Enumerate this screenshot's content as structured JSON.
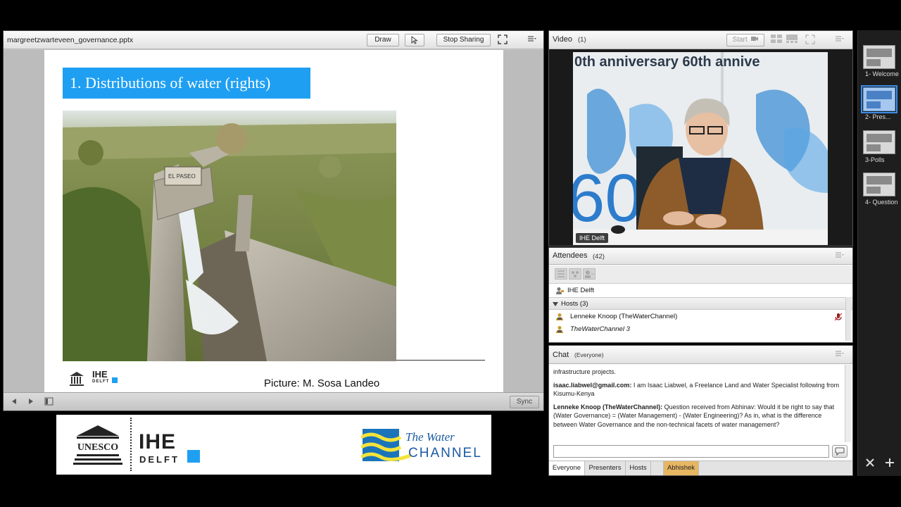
{
  "share_pod": {
    "filename": "margreetzwarteveen_governance.pptx",
    "draw_label": "Draw",
    "stop_sharing_label": "Stop Sharing",
    "sync_label": "Sync"
  },
  "slide": {
    "title": "1. Distributions of water (rights)",
    "logo_text": "IHE",
    "logo_sub": "DELFT",
    "caption": "Picture: M. Sosa Landeo",
    "sign_text": "EL PASEO"
  },
  "banner": {
    "unesco": "UNESCO",
    "ihe": "IHE",
    "delft": "DELFT",
    "wc_line1": "The Water",
    "wc_line2": "CHANNEL"
  },
  "video_pod": {
    "title": "Video",
    "count": "(1)",
    "start_label": "Start",
    "camera_label": "IHE Delft",
    "backdrop_text": "0th anniversary   60th annive",
    "backdrop_num": "60   60"
  },
  "attendees": {
    "title": "Attendees",
    "count": "(42)",
    "presenter": "IHE Delft",
    "hosts_label": "Hosts (3)",
    "hosts": [
      "Lenneke Knoop (TheWaterChannel)",
      "TheWaterChannel 3"
    ]
  },
  "chat": {
    "title": "Chat",
    "scope": "(Everyone)",
    "messages": [
      {
        "sender": "",
        "text": "infrastructure projects."
      },
      {
        "sender": "isaac.liabwel@gmail.com:",
        "text": " I am Isaac Liabwel, a Freelance Land and Water Specialist following from Kisumu-Kenya"
      },
      {
        "sender": "Lenneke Knoop (TheWaterChannel):",
        "text": " Question received from Abhinav: Would it be right to say that (Water Governance) = (Water Management) - (Water Engineering)? As in, what is the difference between Water Governance and the non-technical facets of water management?"
      }
    ],
    "tabs": [
      "Everyone",
      "Presenters",
      "Hosts",
      "Abhishek"
    ]
  },
  "thumbnails": [
    {
      "label": "1- Welcome"
    },
    {
      "label": "2- Pres..."
    },
    {
      "label": "3-Polls"
    },
    {
      "label": "4- Question"
    }
  ],
  "colors": {
    "accent_blue": "#1e9ff2",
    "tab_highlight": "#e7b663",
    "selected_thumb": "#3e8ee8"
  }
}
